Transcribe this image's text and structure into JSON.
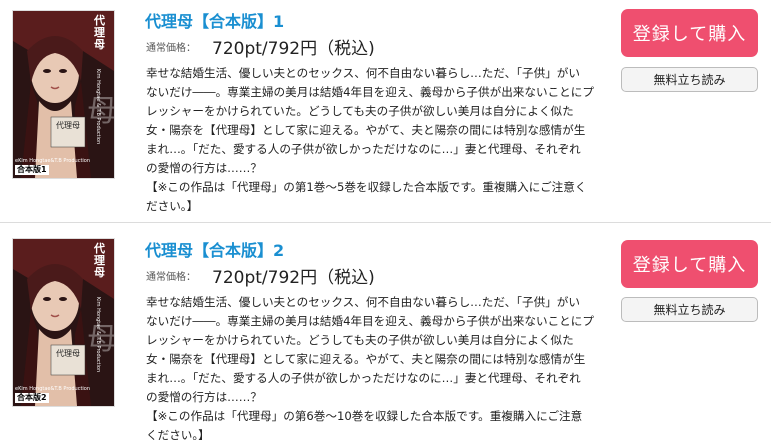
{
  "common": {
    "price_label": "通常価格：",
    "buy_button": "登録して購入",
    "trial_button": "無料立ち読み"
  },
  "colors": {
    "title": "#1a8fd1",
    "buy_button_bg": "#ef4f6f",
    "trial_button_bg": "#f4f4f4"
  },
  "items": [
    {
      "title": "代理母【合本版】1",
      "price": "720pt/792円（税込)",
      "cover": {
        "series_label": "代理母",
        "title_mark": "代理母",
        "volume_tag": "合本版1",
        "credit": "Kim Hongtae & T.B Production",
        "credit_bottom": "eKim Hongtae&T.B Production"
      },
      "description": [
        "幸せな結婚生活、優しい夫とのセックス、何不自由ない暮らし…ただ、「子供」がい",
        "ないだけ――。専業主婦の美月は結婚4年目を迎え、義母から子供が出来ないことにプ",
        "レッシャーをかけられていた。どうしても夫の子供が欲しい美月は自分によく似た",
        "女・陽奈を【代理母】として家に迎える。やがて、夫と陽奈の間には特別な感情が生",
        "まれ…。「だた、愛する人の子供が欲しかっただけなのに…」妻と代理母、それぞれ",
        "の愛憎の行方は……？",
        "【※この作品は「代理母」の第1巻〜5巻を収録した合本版です。重複購入にご注意く",
        "ださい。】"
      ]
    },
    {
      "title": "代理母【合本版】2",
      "price": "720pt/792円（税込)",
      "cover": {
        "series_label": "代理母",
        "title_mark": "代理母",
        "volume_tag": "合本版2",
        "credit": "Kim Hongtae & T.B Production",
        "credit_bottom": "eKim Hongtae&T.B Production"
      },
      "description": [
        "幸せな結婚生活、優しい夫とのセックス、何不自由ない暮らし…ただ、「子供」がい",
        "ないだけ――。専業主婦の美月は結婚4年目を迎え、義母から子供が出来ないことにプ",
        "レッシャーをかけられていた。どうしても夫の子供が欲しい美月は自分によく似た",
        "女・陽奈を【代理母】として家に迎える。やがて、夫と陽奈の間には特別な感情が生",
        "まれ…。「だた、愛する人の子供が欲しかっただけなのに…」妻と代理母、それぞれ",
        "の愛憎の行方は……？",
        "【※この作品は「代理母」の第6巻〜10巻を収録した合本版です。重複購入にご注意",
        "ください。】"
      ]
    }
  ]
}
